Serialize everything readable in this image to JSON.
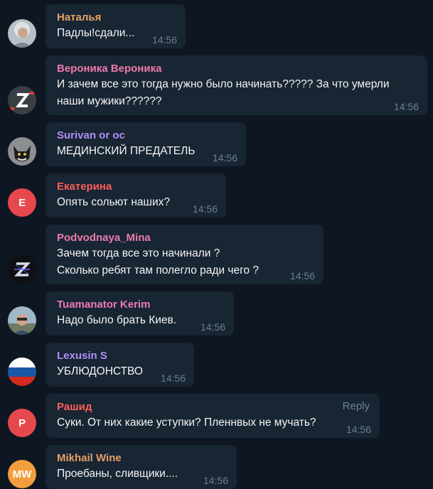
{
  "messages": [
    {
      "name": "Наталья",
      "name_color": "#e5a064",
      "lines": [
        "Падлы!сдали..."
      ],
      "time": "14:56",
      "avatar": {
        "type": "photo-woman",
        "icon": "avatar-photo-woman"
      }
    },
    {
      "name": "Вероника Вероника",
      "name_color": "#ee7aae",
      "lines": [
        "И зачем все это тогда нужно было начинать????? За что умерли",
        "наши мужики??????"
      ],
      "time": "14:56",
      "avatar": {
        "type": "z-letter",
        "icon": "avatar-z-symbol"
      }
    },
    {
      "name": "Surivan or oc",
      "name_color": "#b18ef5",
      "lines": [
        "МЕДИНСКИЙ ПРЕДАТЕЛЬ"
      ],
      "time": "14:56",
      "avatar": {
        "type": "photo-cat",
        "icon": "avatar-photo-cat"
      }
    },
    {
      "name": "Екатерина",
      "name_color": "#ff5d5a",
      "lines": [
        "Опять сольют наших?"
      ],
      "time": "14:56",
      "avatar": {
        "type": "initials",
        "initials": "Е",
        "bg": "#e5484d",
        "icon": "avatar-initials"
      }
    },
    {
      "name": "Podvodnaya_Mina",
      "name_color": "#ee7aae",
      "lines": [
        "Зачем тогда все это начинали ?",
        "Сколько ребят там полегло ради чего ?"
      ],
      "time": "14:56",
      "avatar": {
        "type": "z-dark",
        "icon": "avatar-z-neon"
      }
    },
    {
      "name": "Tuamanator Kerim",
      "name_color": "#ee7aae",
      "lines": [
        "Надо было брать Киев."
      ],
      "time": "14:56",
      "avatar": {
        "type": "photo-man",
        "icon": "avatar-photo-man"
      }
    },
    {
      "name": "Lexusin S",
      "name_color": "#b18ef5",
      "lines": [
        "УБЛЮДОНСТВО"
      ],
      "time": "14:56",
      "avatar": {
        "type": "flag-russia",
        "icon": "avatar-flag-russia"
      }
    },
    {
      "name": "Рашид",
      "name_color": "#ff5d5a",
      "lines": [
        "Суки. От них какие уступки? Пленнвых не мучать?"
      ],
      "time": "14:56",
      "reply": "Reply",
      "avatar": {
        "type": "initials",
        "initials": "Р",
        "bg": "#e5484d",
        "icon": "avatar-initials"
      }
    },
    {
      "name": "Mikhail Wine",
      "name_color": "#e5a064",
      "lines": [
        "Проебаны, сливщики...."
      ],
      "time": "14:56",
      "avatar": {
        "type": "initials",
        "initials": "MW",
        "bg": "#f29e3e",
        "icon": "avatar-initials"
      }
    }
  ]
}
